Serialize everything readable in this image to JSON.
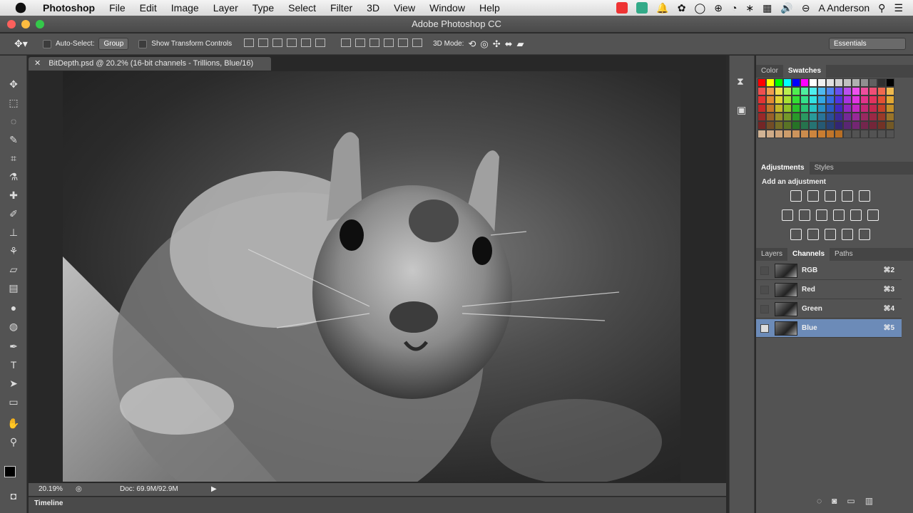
{
  "menubar": {
    "app": "Photoshop",
    "items": [
      "File",
      "Edit",
      "Image",
      "Layer",
      "Type",
      "Select",
      "Filter",
      "3D",
      "View",
      "Window",
      "Help"
    ],
    "user": "A Anderson"
  },
  "window": {
    "title": "Adobe Photoshop CC"
  },
  "options": {
    "auto_select_label": "Auto-Select:",
    "auto_select_value": "Group",
    "transform_label": "Show Transform Controls",
    "mode_3d_label": "3D Mode:",
    "workspace": "Essentials"
  },
  "document": {
    "tab": "BitDepth.psd @ 20.2% (16-bit channels - Trillions, Blue/16)",
    "zoom": "20.19%",
    "doc_size": "Doc: 69.9M/92.9M"
  },
  "timeline": {
    "label": "Timeline"
  },
  "panels": {
    "color_tabs": [
      "Color",
      "Swatches"
    ],
    "adjust_tabs": [
      "Adjustments",
      "Styles"
    ],
    "adjust_title": "Add an adjustment",
    "layer_tabs": [
      "Layers",
      "Channels",
      "Paths"
    ],
    "channels": [
      {
        "name": "RGB",
        "shortcut": "⌘2"
      },
      {
        "name": "Red",
        "shortcut": "⌘3"
      },
      {
        "name": "Green",
        "shortcut": "⌘4"
      },
      {
        "name": "Blue",
        "shortcut": "⌘5"
      }
    ]
  },
  "swatch_colors": [
    "#ff0000",
    "#ffff00",
    "#00ff00",
    "#00ffff",
    "#0000ff",
    "#ff00ff",
    "#ffffff",
    "#f0f0f0",
    "#e0e0e0",
    "#d0d0d0",
    "#c0c0c0",
    "#b0b0b0",
    "#909090",
    "#606060",
    "#303030",
    "#000000"
  ]
}
